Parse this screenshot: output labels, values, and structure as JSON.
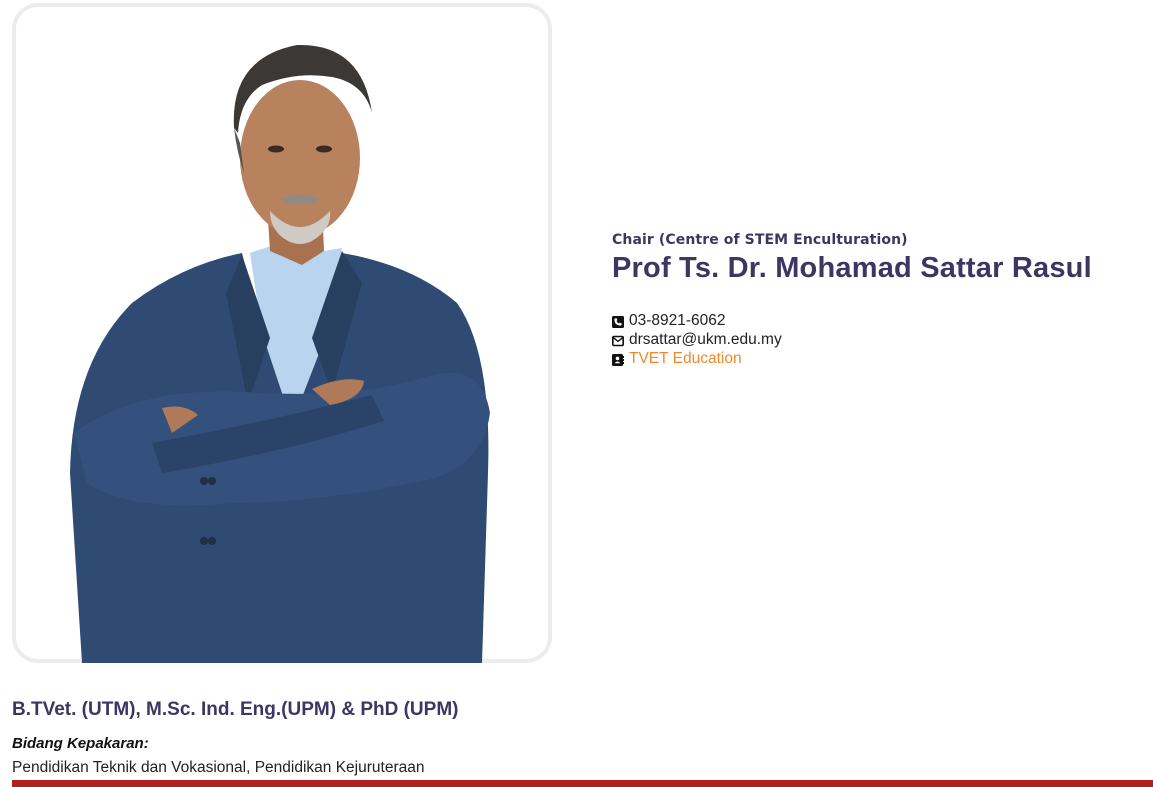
{
  "profile": {
    "role": "Chair (Centre of STEM Enculturation)",
    "name": "Prof Ts. Dr. Mohamad Sattar Rasul",
    "phone": "03-8921-6062",
    "email": "drsattar@ukm.edu.my",
    "department": "TVET Education",
    "degrees": "B.TVet. (UTM), M.Sc. Ind. Eng.(UPM) & PhD (UPM)",
    "expertise_label": "Bidang Kepakaran:",
    "expertise": "Pendidikan Teknik dan Vokasional, Pendidikan Kejuruteraan"
  },
  "icons": {
    "phone": "phone-icon",
    "email": "envelope-icon",
    "department": "address-book-icon"
  },
  "colors": {
    "heading": "#3b3763",
    "link": "#f0892a",
    "accent_bar": "#b0201c"
  }
}
